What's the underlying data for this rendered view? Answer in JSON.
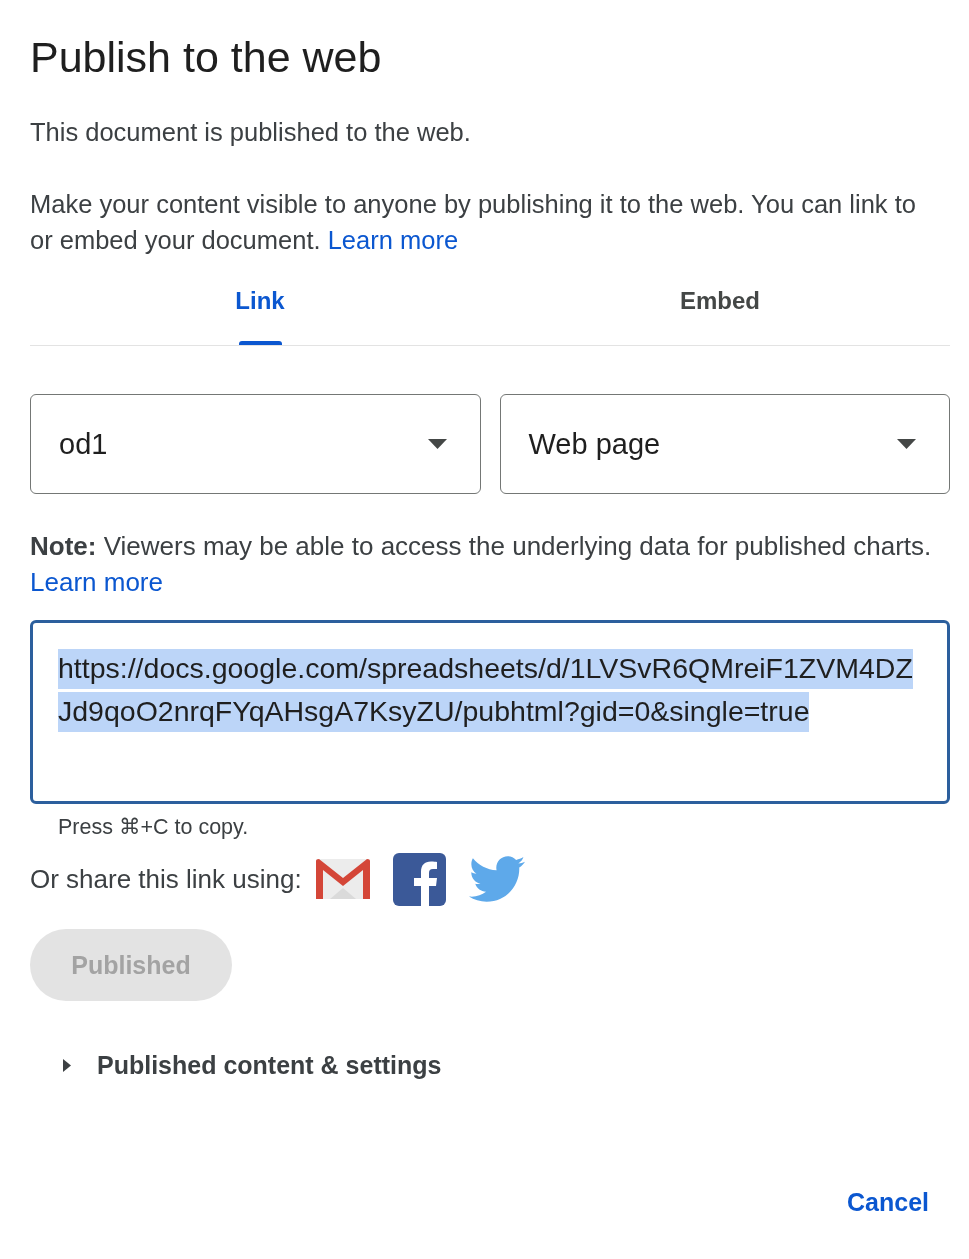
{
  "dialog": {
    "title": "Publish to the web",
    "status": "This document is published to the web.",
    "description": "Make your content visible to anyone by publishing it to the web. You can link to or embed your document.",
    "description_link": "Learn more"
  },
  "tabs": [
    {
      "label": "Link",
      "selected": true
    },
    {
      "label": "Embed",
      "selected": false
    }
  ],
  "dropdowns": [
    {
      "value": "od1"
    },
    {
      "value": "Web page"
    }
  ],
  "note": {
    "text": "**Note:** Viewers may be able to access the underlying data for published charts.",
    "link": "Learn more"
  },
  "url_field": {
    "value": "https://docs.google.com/spreadsheets/d/1LVSvR6QMreiF1ZVM4DZJd9qoO2nrqFYqAHsgA7KsyZU/pubhtml?gid=0&single=true",
    "text_selected": true
  },
  "copy_hint": "Press ⌘+C to copy.",
  "share": {
    "label": "Or share this link using:",
    "services": [
      {
        "kind": "gmail"
      },
      {
        "kind": "facebook"
      },
      {
        "kind": "twitter"
      }
    ]
  },
  "publish_button": {
    "label": "Published",
    "disabled": true
  },
  "settings_section": {
    "label": "Published content & settings",
    "expanded": false
  },
  "footer_buttons": [
    "Cancel"
  ]
}
